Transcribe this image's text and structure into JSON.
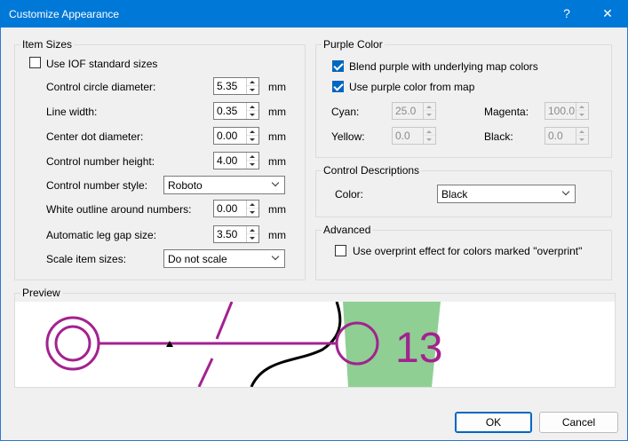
{
  "window": {
    "title": "Customize Appearance",
    "help_label": "?",
    "close_label": "✕"
  },
  "item_sizes": {
    "legend": "Item Sizes",
    "use_iof_label": "Use IOF standard sizes",
    "use_iof_checked": false,
    "circle_diameter_label": "Control circle diameter:",
    "circle_diameter_value": "5.35",
    "line_width_label": "Line width:",
    "line_width_value": "0.35",
    "center_dot_label": "Center dot diameter:",
    "center_dot_value": "0.00",
    "number_height_label": "Control number height:",
    "number_height_value": "4.00",
    "number_style_label": "Control number style:",
    "number_style_value": "Roboto",
    "outline_label": "White outline around numbers:",
    "outline_value": "0.00",
    "leg_gap_label": "Automatic leg gap size:",
    "leg_gap_value": "3.50",
    "scale_label": "Scale item sizes:",
    "scale_value": "Do not scale",
    "unit": "mm"
  },
  "purple_color": {
    "legend": "Purple Color",
    "blend_label": "Blend purple with underlying map colors",
    "blend_checked": true,
    "use_map_label": "Use purple color from map",
    "use_map_checked": true,
    "cyan_label": "Cyan:",
    "cyan_value": "25.0",
    "magenta_label": "Magenta:",
    "magenta_value": "100.0",
    "yellow_label": "Yellow:",
    "yellow_value": "0.0",
    "black_label": "Black:",
    "black_value": "0.0"
  },
  "control_descriptions": {
    "legend": "Control Descriptions",
    "color_label": "Color:",
    "color_value": "Black"
  },
  "advanced": {
    "legend": "Advanced",
    "overprint_label": "Use overprint effect for colors marked \"overprint\"",
    "overprint_checked": false
  },
  "preview": {
    "legend": "Preview",
    "control_number": "13",
    "purple": "#a3228f",
    "green": "#8fcf94"
  },
  "buttons": {
    "ok_label": "OK",
    "cancel_label": "Cancel"
  }
}
